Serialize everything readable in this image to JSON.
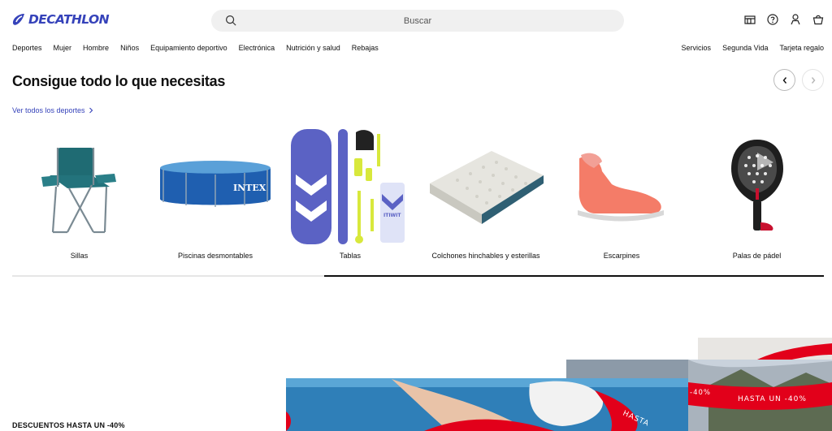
{
  "header": {
    "brand": "DECATHLON",
    "search_placeholder": "Buscar",
    "icons": [
      "store-icon",
      "help-icon",
      "account-icon",
      "cart-icon"
    ]
  },
  "nav": {
    "left": [
      "Deportes",
      "Mujer",
      "Hombre",
      "Niños",
      "Equipamiento deportivo",
      "Electrónica",
      "Nutrición y salud",
      "Rebajas"
    ],
    "right": [
      "Servicios",
      "Segunda Vida",
      "Tarjeta regalo"
    ]
  },
  "section": {
    "title": "Consigue todo lo que necesitas",
    "see_all": "Ver todos los deportes"
  },
  "carousel": {
    "items": [
      {
        "label": "Sillas",
        "icon": "folding-chair"
      },
      {
        "label": "Piscinas desmontables",
        "icon": "pool"
      },
      {
        "label": "Tablas",
        "icon": "paddle-board"
      },
      {
        "label": "Colchones hinchables y esterillas",
        "icon": "air-mattress"
      },
      {
        "label": "Escarpines",
        "icon": "water-shoe"
      },
      {
        "label": "Palas de pádel",
        "icon": "padel-racket"
      }
    ],
    "progress": 0.62
  },
  "promo": {
    "title": "DESCUENTOS HASTA UN -40%",
    "banner_text_1": "HASTA UN -40%",
    "banner_text_2": "-40%",
    "banner_text_3": "HASTA",
    "intex_label": "INTEX",
    "board_brand": "ITIWIT"
  },
  "colors": {
    "brand": "#3643ba",
    "accent_red": "#e2001a"
  }
}
